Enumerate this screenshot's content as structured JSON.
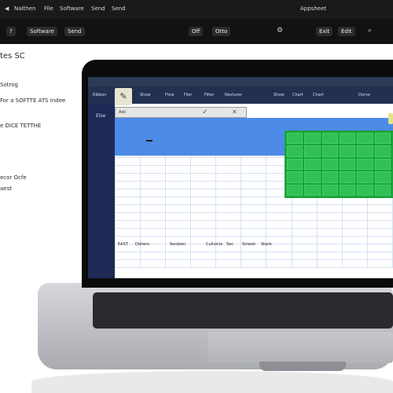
{
  "background": {
    "menubar": {
      "left_text": "Nalthen",
      "items": [
        "File",
        "Software",
        "Send",
        "Send"
      ],
      "right_text": "Appsheet"
    },
    "toolbar": {
      "left_items": [
        "?",
        "Software",
        "Send"
      ],
      "right_items": [
        "Off",
        "Otto",
        "Exit",
        "Edit"
      ]
    },
    "left_doc": {
      "title": "tes SC",
      "lines": [
        "Sotrog",
        "For a SOFTTE ATS Indee",
        "e DICE TETTHE",
        "ecor Ocfe",
        "aest"
      ]
    }
  },
  "laptop": {
    "screen": {
      "ribbon": {
        "tabs": [
          "Ribbon",
          "Show",
          "Flow",
          "Filer",
          "Filter",
          "Nexturer",
          "Show",
          "Chart",
          "Chart",
          "Dorve"
        ],
        "home_icon": "pencil-icon"
      },
      "left_panel_label": "Else",
      "formula_bar_text": "Adv",
      "row_labels": [
        "EAST",
        "Dieters",
        "Seroken",
        "Cullvicts",
        "Sec",
        "Smeek",
        "Stack"
      ]
    }
  },
  "colors": {
    "accent_blue": "#4d8be8",
    "grid_green": "#1ba43c"
  }
}
